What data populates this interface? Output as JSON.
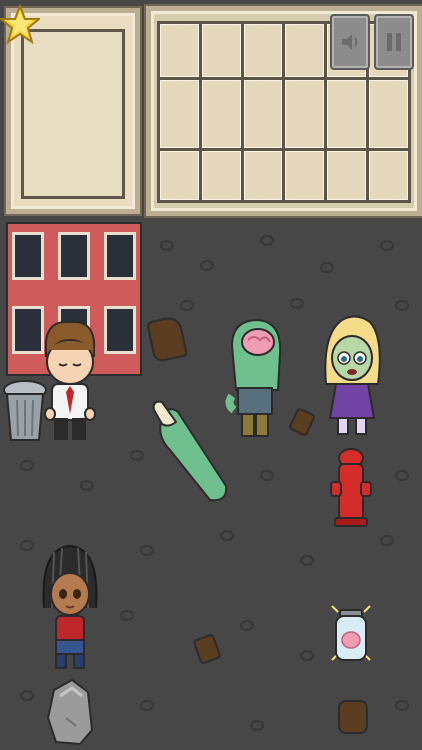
{
  "colors": {
    "street": "#474747",
    "panel": "#e9dcc0",
    "building": "#cf5b5b",
    "zombie_skin": "#6fbf8f",
    "hydrant": "#d42b2b"
  },
  "hud": {
    "star_icon": "star-icon",
    "sound_button_icon": "sound-icon",
    "pause_button_icon": "pause-icon"
  },
  "characters": [
    {
      "name": "man-in-shirt-and-tie"
    },
    {
      "name": "zombie-with-exposed-brain"
    },
    {
      "name": "blonde-zombie-girl"
    },
    {
      "name": "girl-with-braids"
    }
  ],
  "props": [
    "trash-can",
    "zombie-hand",
    "fire-hydrant",
    "brain-jar",
    "rock",
    "ground-crack"
  ]
}
